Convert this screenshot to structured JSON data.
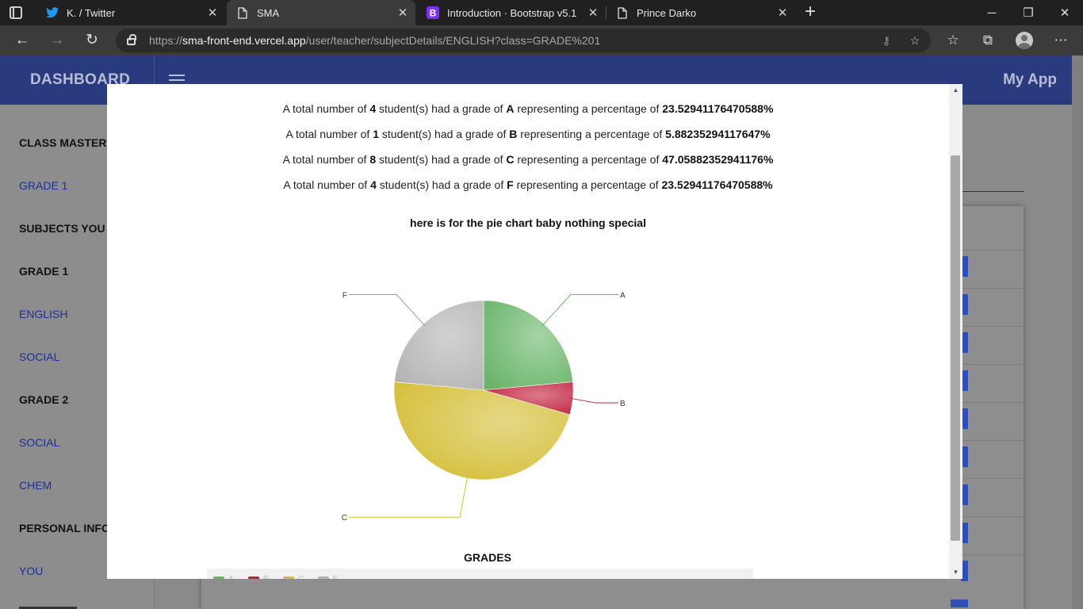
{
  "browser": {
    "tabs": [
      {
        "title": "K. / Twitter",
        "icon": "twitter-icon",
        "active": false
      },
      {
        "title": "SMA",
        "icon": "page-icon",
        "active": true
      },
      {
        "title": "Introduction · Bootstrap v5.1",
        "icon": "bootstrap-icon",
        "active": false
      },
      {
        "title": "Prince Darko",
        "icon": "page-icon",
        "active": false
      }
    ],
    "url_prefix": "https://",
    "url_host": "sma-front-end.vercel.app",
    "url_path": "/user/teacher/subjectDetails/ENGLISH?class=GRADE%201"
  },
  "navbar": {
    "brand": "DASHBOARD",
    "app_name": "My App"
  },
  "sidebar": {
    "items": [
      {
        "label": "CLASS MASTER",
        "type": "head"
      },
      {
        "label": "GRADE 1",
        "type": "link"
      },
      {
        "label": "SUBJECTS YOU T",
        "type": "head"
      },
      {
        "label": "GRADE 1",
        "type": "head"
      },
      {
        "label": "ENGLISH",
        "type": "link"
      },
      {
        "label": "SOCIAL",
        "type": "link"
      },
      {
        "label": "GRADE 2",
        "type": "head"
      },
      {
        "label": "SOCIAL",
        "type": "link"
      },
      {
        "label": "CHEM",
        "type": "link"
      },
      {
        "label": "PERSONAL INFO",
        "type": "head"
      },
      {
        "label": "YOU",
        "type": "link"
      }
    ]
  },
  "modal": {
    "sentence": {
      "prefix": "A total number of",
      "middle": "student(s) had a grade of",
      "suffix": "representing a percentage of"
    },
    "grade_lines": [
      {
        "count": "4",
        "grade": "A",
        "percentage": "23.52941176470588%"
      },
      {
        "count": "1",
        "grade": "B",
        "percentage": "5.88235294117647%"
      },
      {
        "count": "8",
        "grade": "C",
        "percentage": "47.05882352941176%"
      },
      {
        "count": "4",
        "grade": "F",
        "percentage": "23.52941176470588%"
      }
    ],
    "chart_title": "here is for the pie chart baby nothing special",
    "legend_title": "GRADES"
  },
  "chart_data": {
    "type": "pie",
    "title": "here is for the pie chart baby nothing special",
    "categories": [
      "A",
      "B",
      "C",
      "F"
    ],
    "values": [
      4,
      1,
      8,
      4
    ],
    "colors": [
      "#6ab56a",
      "#c2213e",
      "#d4be36",
      "#b4b4b4"
    ],
    "legend_title": "GRADES",
    "legend": "bottom"
  }
}
